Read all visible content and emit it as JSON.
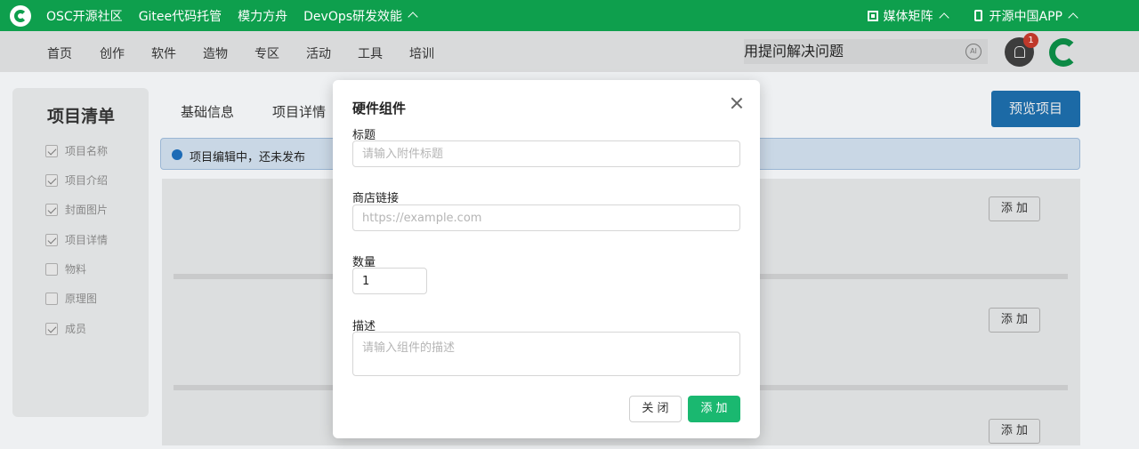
{
  "topbar": {
    "links": [
      "OSC开源社区",
      "Gitee代码托管",
      "模力方舟",
      "DevOps研发效能"
    ],
    "media": "媒体矩阵",
    "app": "开源中国APP",
    "brand_color": "#0e9f4d"
  },
  "nav": {
    "items": [
      "首页",
      "创作",
      "软件",
      "造物",
      "专区",
      "活动",
      "工具",
      "培训"
    ],
    "search_placeholder": "用提问解决问题",
    "notification_count": "1",
    "ai_label": "AI"
  },
  "sidebar": {
    "title": "项目清单",
    "items": [
      {
        "label": "项目名称",
        "checked": true
      },
      {
        "label": "项目介绍",
        "checked": true
      },
      {
        "label": "封面图片",
        "checked": true
      },
      {
        "label": "项目详情",
        "checked": true
      },
      {
        "label": "物料",
        "checked": false
      },
      {
        "label": "原理图",
        "checked": false
      },
      {
        "label": "成员",
        "checked": true
      }
    ]
  },
  "main": {
    "tabs": [
      "基础信息",
      "项目详情"
    ],
    "preview_label": "预览项目",
    "notice": "项目编辑中，还未发布",
    "add_label": "添 加"
  },
  "modal": {
    "title": "硬件组件",
    "fields": {
      "title_label": "标题",
      "title_placeholder": "请输入附件标题",
      "link_label": "商店链接",
      "link_placeholder": "https://example.com",
      "qty_label": "数量",
      "qty_value": "1",
      "desc_label": "描述",
      "desc_placeholder": "请输入组件的描述"
    },
    "close_label": "关 闭",
    "add_label": "添 加",
    "accent": "#1ab870"
  }
}
